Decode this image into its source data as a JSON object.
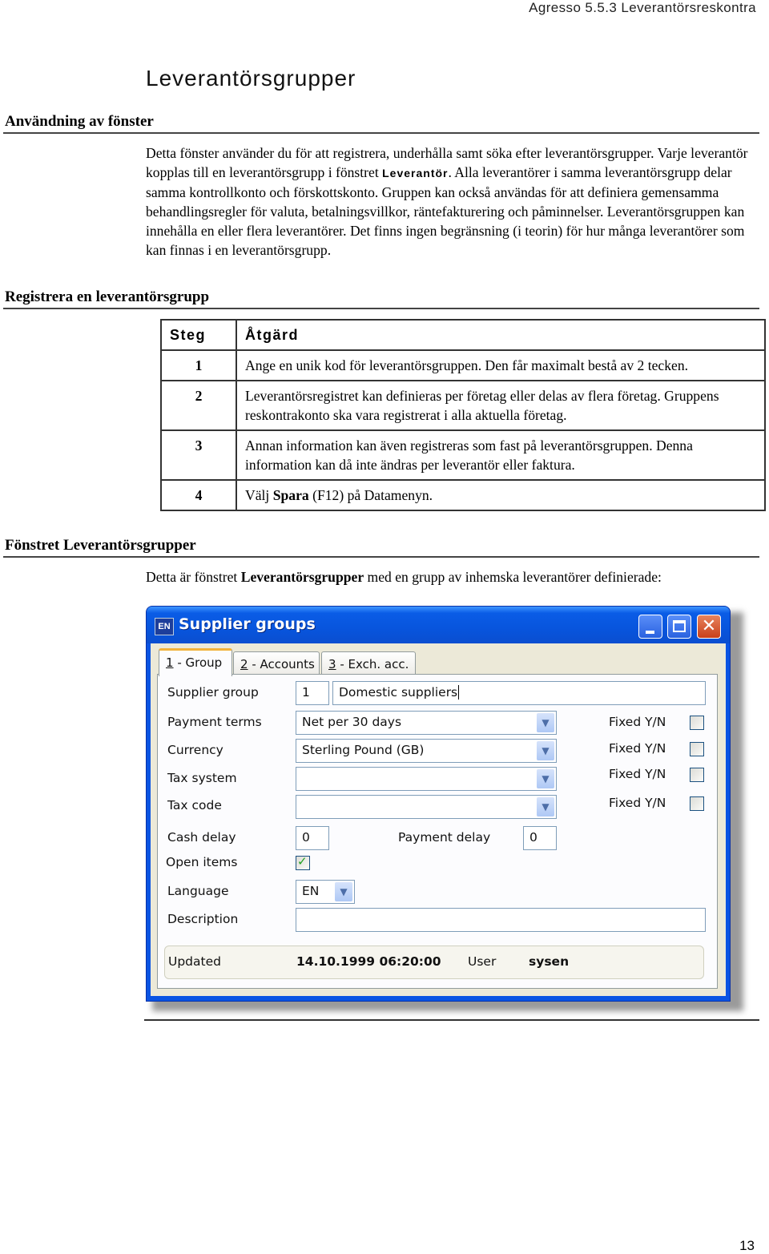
{
  "header": {
    "running_title": "Agresso 5.5.3 Leverantörsreskontra"
  },
  "page_title": "Leverantörsgrupper",
  "sections": {
    "usage": {
      "heading": "Användning av fönster",
      "para_before": "Detta fönster använder du för att registrera, underhålla samt söka efter leverantörsgrupper. Varje leverantör kopplas till en leverantörsgrupp i fönstret ",
      "para_bold": "Leverantör",
      "para_after": ". Alla leverantörer i samma leverantörsgrupp delar samma kontrollkonto och förskottskonto. Gruppen kan också användas för att definiera gemensamma behandlingsregler för valuta, betalningsvillkor, räntefakturering och påminnelser. Leverantörsgruppen kan innehålla en eller flera leverantörer. Det finns ingen begränsning (i teorin) för hur många leverantörer som kan finnas i en leverantörsgrupp."
    },
    "register": {
      "heading": "Registrera en leverantörsgrupp",
      "table": {
        "headers": [
          "Steg",
          "Åtgärd"
        ],
        "rows": [
          {
            "step": "1",
            "text": "Ange en unik kod för leverantörsgruppen. Den får maximalt bestå av 2 tecken."
          },
          {
            "step": "2",
            "text": "Leverantörsregistret kan definieras per företag eller delas av flera företag. Gruppens reskontrakonto ska vara registrerat i alla aktuella företag."
          },
          {
            "step": "3",
            "text": "Annan information kan även registreras som fast på leverantörsgruppen. Denna information kan då inte ändras per leverantör eller faktura."
          },
          {
            "step": "4",
            "text_before": "Välj ",
            "text_bold": "Spara",
            "text_after": " (F12) på Datamenyn."
          }
        ]
      }
    },
    "window_section": {
      "heading": "Fönstret Leverantörsgrupper",
      "intro_before": "Detta är fönstret ",
      "intro_bold": "Leverantörsgrupper",
      "intro_after": " med en grupp av inhemska leverantörer definierade:"
    }
  },
  "window": {
    "app_icon": "EN",
    "title": "Supplier groups",
    "buttons": {
      "minimize": "minimize-icon",
      "maximize": "maximize-icon",
      "close": "✕"
    },
    "tabs": [
      {
        "key": "1",
        "label": " - Group",
        "active": true
      },
      {
        "key": "2",
        "label": " - Accounts",
        "active": false
      },
      {
        "key": "3",
        "label": " - Exch. acc.",
        "active": false
      }
    ],
    "fields": {
      "supplier_group": {
        "label": "Supplier group",
        "code": "1",
        "name": "Domestic suppliers"
      },
      "payment_terms": {
        "label": "Payment terms",
        "value": "Net per 30 days",
        "fixed_label": "Fixed Y/N",
        "fixed": false
      },
      "currency": {
        "label": "Currency",
        "value": "Sterling Pound (GB)",
        "fixed_label": "Fixed Y/N",
        "fixed": false
      },
      "tax_system": {
        "label": "Tax system",
        "value": "",
        "fixed_label": "Fixed Y/N",
        "fixed": false
      },
      "tax_code": {
        "label": "Tax code",
        "value": "",
        "fixed_label": "Fixed Y/N",
        "fixed": false
      },
      "cash_delay": {
        "label": "Cash delay",
        "value": "0"
      },
      "payment_delay": {
        "label": "Payment delay",
        "value": "0"
      },
      "open_items": {
        "label": "Open items",
        "checked": true
      },
      "language": {
        "label": "Language",
        "value": "EN"
      },
      "description": {
        "label": "Description",
        "value": ""
      }
    },
    "status": {
      "updated_label": "Updated",
      "updated_value": "14.10.1999 06:20:00",
      "user_label": "User",
      "user_value": "sysen"
    }
  },
  "footer": {
    "page_number": "13"
  }
}
